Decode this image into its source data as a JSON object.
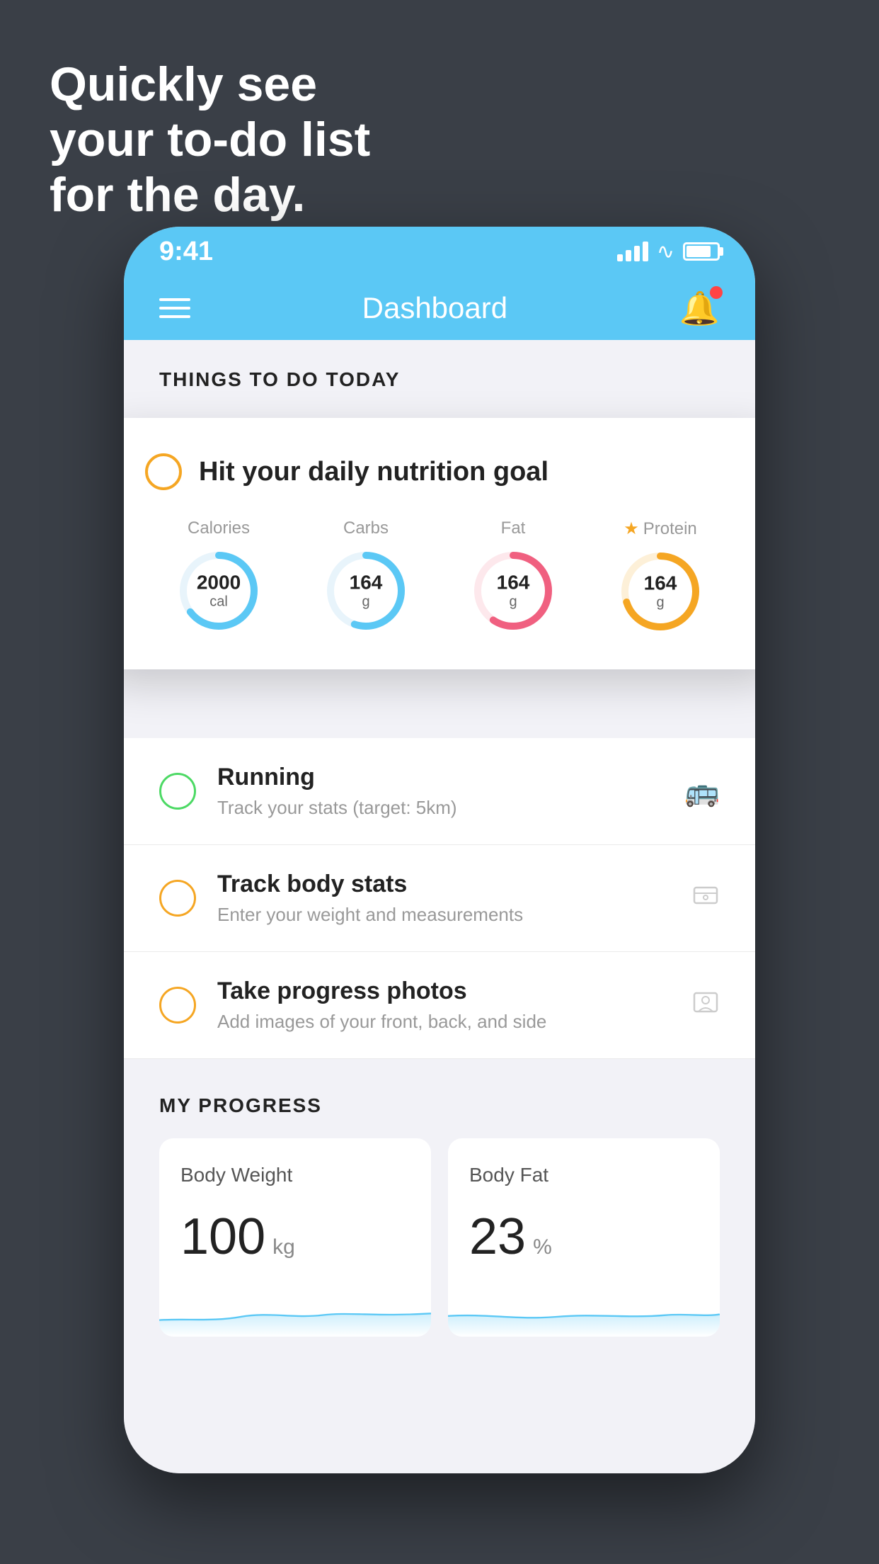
{
  "page": {
    "background_color": "#3a3f47"
  },
  "hero": {
    "line1": "Quickly see",
    "line2": "your to-do list",
    "line3": "for the day."
  },
  "status_bar": {
    "time": "9:41",
    "signal_label": "signal",
    "wifi_label": "wifi",
    "battery_label": "battery"
  },
  "nav": {
    "title": "Dashboard",
    "hamburger_label": "menu",
    "bell_label": "notifications"
  },
  "section_title": "THINGS TO DO TODAY",
  "floating_card": {
    "title": "Hit your daily nutrition goal",
    "macros": [
      {
        "label": "Calories",
        "value": "2000",
        "unit": "cal",
        "color": "#5bc8f5",
        "pct": 65,
        "starred": false
      },
      {
        "label": "Carbs",
        "value": "164",
        "unit": "g",
        "color": "#5bc8f5",
        "pct": 55,
        "starred": false
      },
      {
        "label": "Fat",
        "value": "164",
        "unit": "g",
        "color": "#f06080",
        "pct": 60,
        "starred": false
      },
      {
        "label": "Protein",
        "value": "164",
        "unit": "g",
        "color": "#f5a623",
        "pct": 70,
        "starred": true
      }
    ]
  },
  "todo_items": [
    {
      "title": "Running",
      "subtitle": "Track your stats (target: 5km)",
      "circle_color": "green",
      "icon": "🥿"
    },
    {
      "title": "Track body stats",
      "subtitle": "Enter your weight and measurements",
      "circle_color": "yellow",
      "icon": "⬜"
    },
    {
      "title": "Take progress photos",
      "subtitle": "Add images of your front, back, and side",
      "circle_color": "yellow",
      "icon": "👤"
    }
  ],
  "progress": {
    "header": "MY PROGRESS",
    "cards": [
      {
        "title": "Body Weight",
        "value": "100",
        "unit": "kg"
      },
      {
        "title": "Body Fat",
        "value": "23",
        "unit": "%"
      }
    ]
  }
}
